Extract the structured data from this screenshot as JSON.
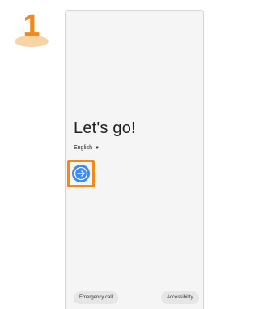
{
  "step": {
    "number": "1"
  },
  "screen": {
    "title": "Let's go!",
    "language": {
      "selected": "English",
      "caret": "▼"
    },
    "start_button_icon": "arrow-right-icon",
    "buttons": {
      "emergency_call": "Emergency call",
      "accessibility": "Accessibility"
    }
  },
  "colors": {
    "accent_orange": "#ef8a1b",
    "start_button_blue": "#3c8af0",
    "screen_background": "#f5f5f5"
  }
}
